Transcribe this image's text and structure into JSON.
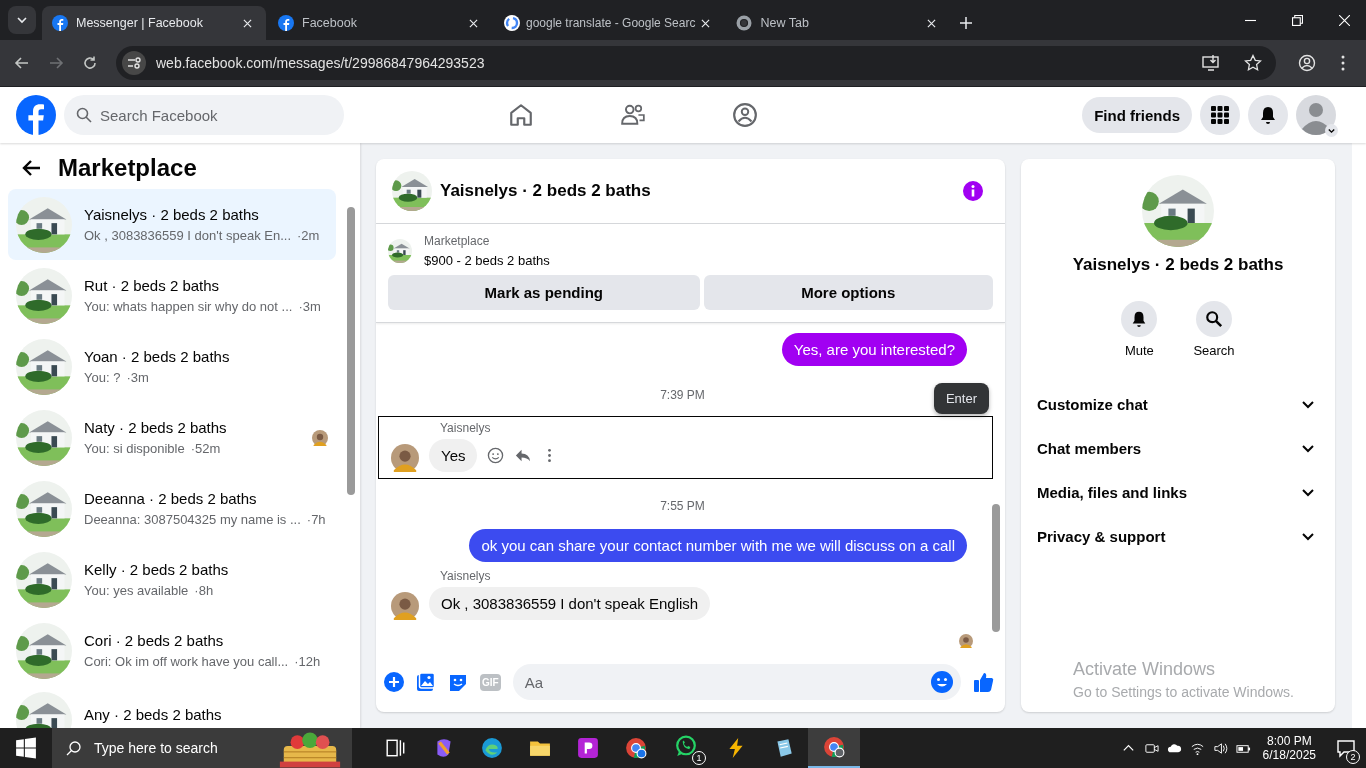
{
  "browser": {
    "tabs": [
      {
        "title": "Messenger | Facebook",
        "selected": true
      },
      {
        "title": "Facebook",
        "selected": false
      },
      {
        "title": "google translate - Google Searc",
        "selected": false
      },
      {
        "title": "New Tab",
        "selected": false
      }
    ],
    "url": "web.facebook.com/messages/t/29986847964293523"
  },
  "header": {
    "search_placeholder": "Search Facebook",
    "find_friends": "Find friends"
  },
  "sidebar": {
    "title": "Marketplace",
    "conversations": [
      {
        "name": "Yaisnelys · 2 beds 2 baths",
        "preview": "Ok , 3083836559 I don't speak En...",
        "time": "·2m",
        "selected": true,
        "read_avatar": false
      },
      {
        "name": "Rut · 2 beds 2 baths",
        "preview": "You: whats happen sir why do not ...",
        "time": "·3m",
        "selected": false,
        "read_avatar": false
      },
      {
        "name": "Yoan · 2 beds 2 baths",
        "preview": "You: ?",
        "time": "·3m",
        "selected": false,
        "read_avatar": false
      },
      {
        "name": "Naty · 2 beds 2 baths",
        "preview": "You: si disponible",
        "time": "·52m",
        "selected": false,
        "read_avatar": true
      },
      {
        "name": "Deeanna · 2 beds 2 baths",
        "preview": "Deeanna: 3087504325 my name is ...",
        "time": "·7h",
        "selected": false,
        "read_avatar": false
      },
      {
        "name": "Kelly · 2 beds 2 baths",
        "preview": "You: yes available",
        "time": "·8h",
        "selected": false,
        "read_avatar": false
      },
      {
        "name": "Cori · 2 beds 2 baths",
        "preview": "Cori: Ok im off work have you call...",
        "time": "·12h",
        "selected": false,
        "read_avatar": false
      },
      {
        "name": "Any · 2 beds 2 baths",
        "selected": false,
        "read_avatar": false
      }
    ]
  },
  "chat": {
    "title": "Yaisnelys · 2 beds 2 baths",
    "listing_label": "Marketplace",
    "listing_title": "$900 - 2 beds 2 baths",
    "actions": [
      "Mark as pending",
      "More options"
    ],
    "messages": [
      {
        "kind": "outgoing",
        "text": "Yes, are you interested?",
        "color": "#a100f2"
      },
      {
        "kind": "time",
        "text": "7:39 PM"
      },
      {
        "kind": "incoming",
        "sender": "Yaisnelys",
        "text": "Yes",
        "hovered": true
      },
      {
        "kind": "time",
        "text": "7:55 PM"
      },
      {
        "kind": "outgoing",
        "text": "ok you can share your contact number with me we will discuss on a call",
        "color": "#3c4bf0"
      },
      {
        "kind": "incoming",
        "sender": "Yaisnelys",
        "text": "Ok , 3083836559 I don't speak English",
        "hovered": false
      }
    ],
    "tooltip": "Enter",
    "composer_placeholder": "Aa",
    "gif": "GIF"
  },
  "details": {
    "title": "Yaisnelys · 2 beds 2 baths",
    "actions": [
      {
        "kind": "mute",
        "label": "Mute"
      },
      {
        "kind": "search",
        "label": "Search"
      }
    ],
    "sections": [
      "Customize chat",
      "Chat members",
      "Media, files and links",
      "Privacy & support"
    ]
  },
  "activation": {
    "title": "Activate Windows",
    "subtitle": "Go to Settings to activate Windows."
  },
  "taskbar": {
    "search_placeholder": "Type here to search",
    "whatsapp_badge": "1",
    "time": "8:00 PM",
    "date": "6/18/2025",
    "notifications": "2"
  }
}
